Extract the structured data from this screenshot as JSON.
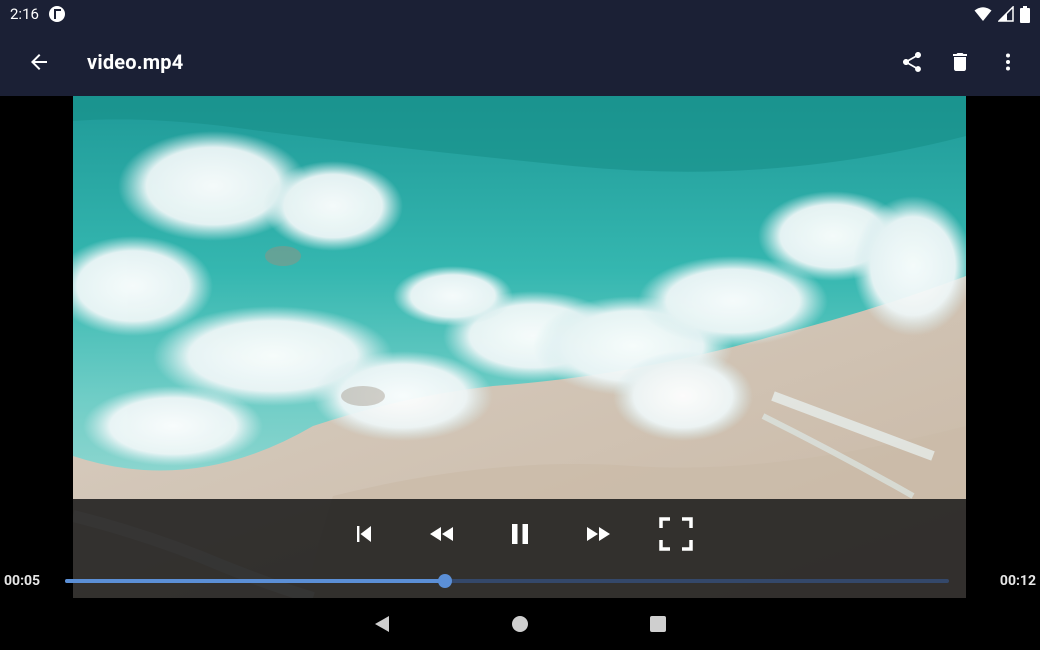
{
  "status_bar": {
    "time": "2:16",
    "icons": [
      "app-notification-icon",
      "wifi-icon",
      "signal-icon",
      "battery-icon"
    ]
  },
  "app_bar": {
    "title": "video.mp4",
    "icons": {
      "back": "arrow-back-icon",
      "share": "share-icon",
      "delete": "delete-icon",
      "more": "more-vert-icon"
    }
  },
  "player": {
    "current_time": "00:05",
    "total_time": "00:12",
    "progress": 0.43,
    "state": "playing",
    "controls": [
      "skip-previous-icon",
      "rewind-icon",
      "pause-icon",
      "fast-forward-icon",
      "fullscreen-icon"
    ]
  },
  "nav_bar": {
    "icons": [
      "nav-back-icon",
      "nav-home-icon",
      "nav-recents-icon"
    ]
  },
  "colors": {
    "app_bar": "#1b2035",
    "accent": "#5b8fd6",
    "track": "#34486a"
  }
}
